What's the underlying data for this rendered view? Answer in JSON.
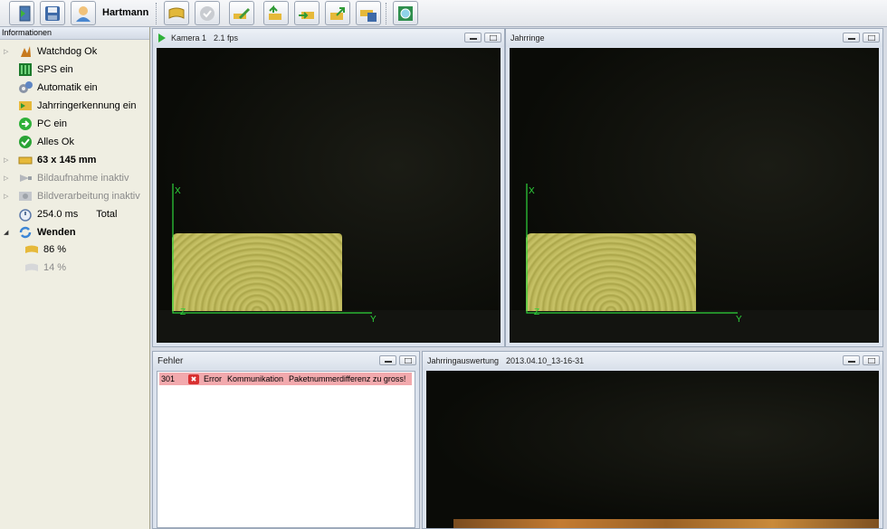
{
  "toolbar": {
    "user": "Hartmann",
    "icons": [
      "login-icon",
      "save-icon",
      "user-icon",
      "wood-board-icon",
      "check-icon",
      "pencil-icon",
      "board-up-icon",
      "board-import-icon",
      "board-export-icon",
      "board-save-icon",
      "camera-settings-icon"
    ]
  },
  "info": {
    "header": "Informationen",
    "items": [
      {
        "label": "Watchdog Ok",
        "icon": "watchdog-icon",
        "expander": true
      },
      {
        "label": "SPS ein",
        "icon": "plc-icon"
      },
      {
        "label": "Automatik ein",
        "icon": "gears-icon"
      },
      {
        "label": "Jahrringerkennung ein",
        "icon": "rings-icon"
      },
      {
        "label": "PC ein",
        "icon": "arrow-right-icon"
      },
      {
        "label": "Alles Ok",
        "icon": "checkmark-icon"
      },
      {
        "label": "63 x 145 mm",
        "icon": "board-icon",
        "expander": true
      },
      {
        "label": "Bildaufnahme inaktiv",
        "icon": "camera-icon",
        "expander": true
      },
      {
        "label": "Bildverarbeitung inaktiv",
        "icon": "processing-icon",
        "expander": true
      },
      {
        "label": "254.0 ms",
        "label2": "Total",
        "icon": "stopwatch-icon"
      },
      {
        "label": "Wenden",
        "icon": "refresh-icon",
        "expander": true
      },
      {
        "label": "86 %",
        "icon": "board-yellow-icon"
      },
      {
        "label": "14 %",
        "icon": "board-grey-icon"
      }
    ]
  },
  "windows": {
    "kamera": {
      "title": "Kamera 1",
      "fps": "2.1 fps"
    },
    "jahrringe": {
      "title": "Jahrringe"
    },
    "fehler": {
      "title": "Fehler"
    },
    "auswertung": {
      "title": "Jahrringauswertung",
      "stamp": "2013.04.10_13-16-31"
    }
  },
  "errors": [
    {
      "code": "301",
      "level": "Error",
      "category": "Kommunikation",
      "message": "Paketnummerdifferenz zu gross!"
    }
  ],
  "axes": {
    "x": "X",
    "y": "Y",
    "z": "Z"
  },
  "colors": {
    "axis": "#2fd43b",
    "wood": "#c4bf63",
    "error_row": "#f2a9ad"
  }
}
